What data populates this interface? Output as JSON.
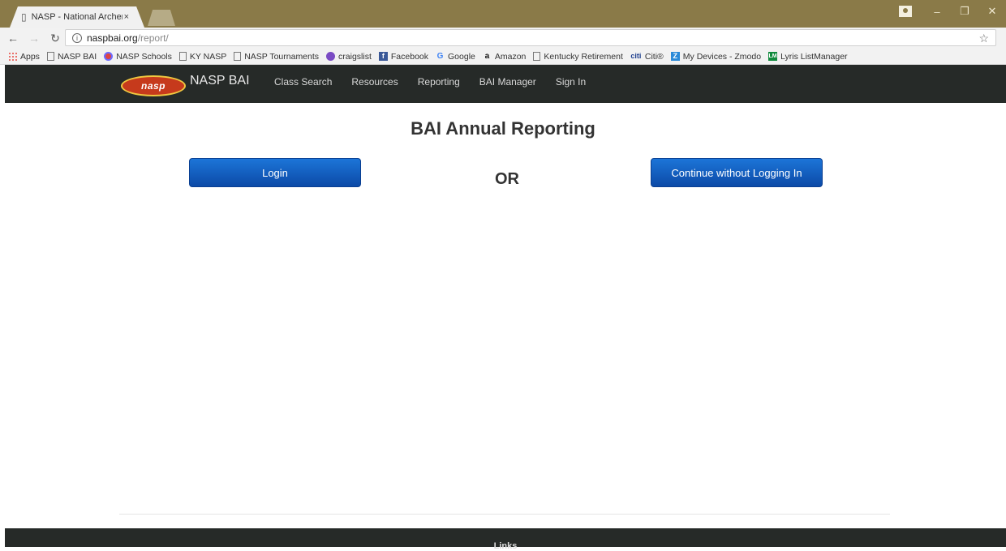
{
  "browser": {
    "tab_title": "NASP - National Archery",
    "tab_close": "×",
    "url_host": "naspbai.org",
    "url_path": "/report/",
    "bookmarks": [
      {
        "label": "Apps",
        "icon": "apps-grid-icon"
      },
      {
        "label": "NASP BAI",
        "icon": "page-icon"
      },
      {
        "label": "NASP Schools",
        "icon": "circle-logo-icon"
      },
      {
        "label": "KY NASP",
        "icon": "page-icon"
      },
      {
        "label": "NASP Tournaments",
        "icon": "page-icon"
      },
      {
        "label": "craigslist",
        "icon": "peace-icon"
      },
      {
        "label": "Facebook",
        "icon": "facebook-icon"
      },
      {
        "label": "Google",
        "icon": "google-icon"
      },
      {
        "label": "Amazon",
        "icon": "amazon-icon"
      },
      {
        "label": "Kentucky Retirement",
        "icon": "page-icon"
      },
      {
        "label": "Citi®",
        "icon": "citi-icon"
      },
      {
        "label": "My Devices - Zmodo",
        "icon": "zmodo-icon"
      },
      {
        "label": "Lyris ListManager",
        "icon": "lyris-icon"
      }
    ]
  },
  "site": {
    "logo_text": "nasp",
    "brand": "NASP BAI",
    "nav": [
      "Class Search",
      "Resources",
      "Reporting",
      "BAI Manager",
      "Sign In"
    ]
  },
  "main": {
    "heading": "BAI Annual Reporting",
    "login_label": "Login",
    "or_label": "OR",
    "continue_label": "Continue without Logging In"
  },
  "footer": {
    "links_label": "Links"
  },
  "colors": {
    "titlebar": "#8a7a48",
    "nav_bg": "#262a28",
    "button": "#1565c0"
  }
}
